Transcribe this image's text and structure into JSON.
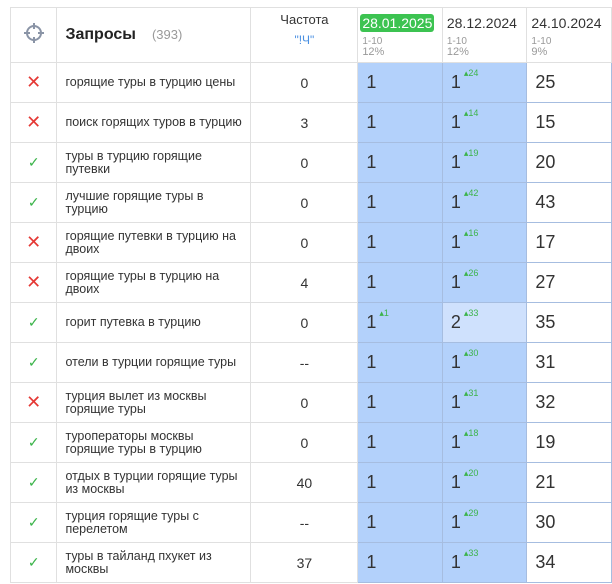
{
  "header": {
    "title": "Запросы",
    "count": "(393)",
    "freq_label": "Частота",
    "freq_mode": "\"!Ч\"",
    "dates": [
      {
        "date": "28.01.2025",
        "range": "1-10",
        "pct": "12%"
      },
      {
        "date": "28.12.2024",
        "range": "1-10",
        "pct": "12%"
      },
      {
        "date": "24.10.2024",
        "range": "1-10",
        "pct": "9%"
      }
    ]
  },
  "rows": [
    {
      "status": "x",
      "q": "горящие туры в турцию цены",
      "f": "0",
      "p1": "1",
      "d1": "",
      "p2": "1",
      "d2": "24",
      "p3": "25"
    },
    {
      "status": "x",
      "q": "поиск горящих туров в турцию",
      "f": "3",
      "p1": "1",
      "d1": "",
      "p2": "1",
      "d2": "14",
      "p3": "15"
    },
    {
      "status": "ok",
      "q": "туры в турцию горящие путевки",
      "f": "0",
      "p1": "1",
      "d1": "",
      "p2": "1",
      "d2": "19",
      "p3": "20"
    },
    {
      "status": "ok",
      "q": "лучшие горящие туры в турцию",
      "f": "0",
      "p1": "1",
      "d1": "",
      "p2": "1",
      "d2": "42",
      "p3": "43"
    },
    {
      "status": "x",
      "q": "горящие путевки в турцию на двоих",
      "f": "0",
      "p1": "1",
      "d1": "",
      "p2": "1",
      "d2": "16",
      "p3": "17"
    },
    {
      "status": "x",
      "q": "горящие туры в турцию на двоих",
      "f": "4",
      "p1": "1",
      "d1": "",
      "p2": "1",
      "d2": "26",
      "p3": "27"
    },
    {
      "status": "ok",
      "q": "горит путевка в турцию",
      "f": "0",
      "p1": "1",
      "d1": "1",
      "p2": "2",
      "d2": "33",
      "p3": "35"
    },
    {
      "status": "ok",
      "q": "отели в турции горящие туры",
      "f": "--",
      "p1": "1",
      "d1": "",
      "p2": "1",
      "d2": "30",
      "p3": "31"
    },
    {
      "status": "x",
      "q": "турция вылет из москвы горящие туры",
      "f": "0",
      "p1": "1",
      "d1": "",
      "p2": "1",
      "d2": "31",
      "p3": "32"
    },
    {
      "status": "ok",
      "q": "туроператоры москвы горящие туры в турцию",
      "f": "0",
      "p1": "1",
      "d1": "",
      "p2": "1",
      "d2": "18",
      "p3": "19"
    },
    {
      "status": "ok",
      "q": "отдых в турции горящие туры из москвы",
      "f": "40",
      "p1": "1",
      "d1": "",
      "p2": "1",
      "d2": "20",
      "p3": "21"
    },
    {
      "status": "ok",
      "q": "турция горящие туры с перелетом",
      "f": "--",
      "p1": "1",
      "d1": "",
      "p2": "1",
      "d2": "29",
      "p3": "30"
    },
    {
      "status": "ok",
      "q": "туры в тайланд пхукет из москвы",
      "f": "37",
      "p1": "1",
      "d1": "",
      "p2": "1",
      "d2": "33",
      "p3": "34"
    }
  ]
}
